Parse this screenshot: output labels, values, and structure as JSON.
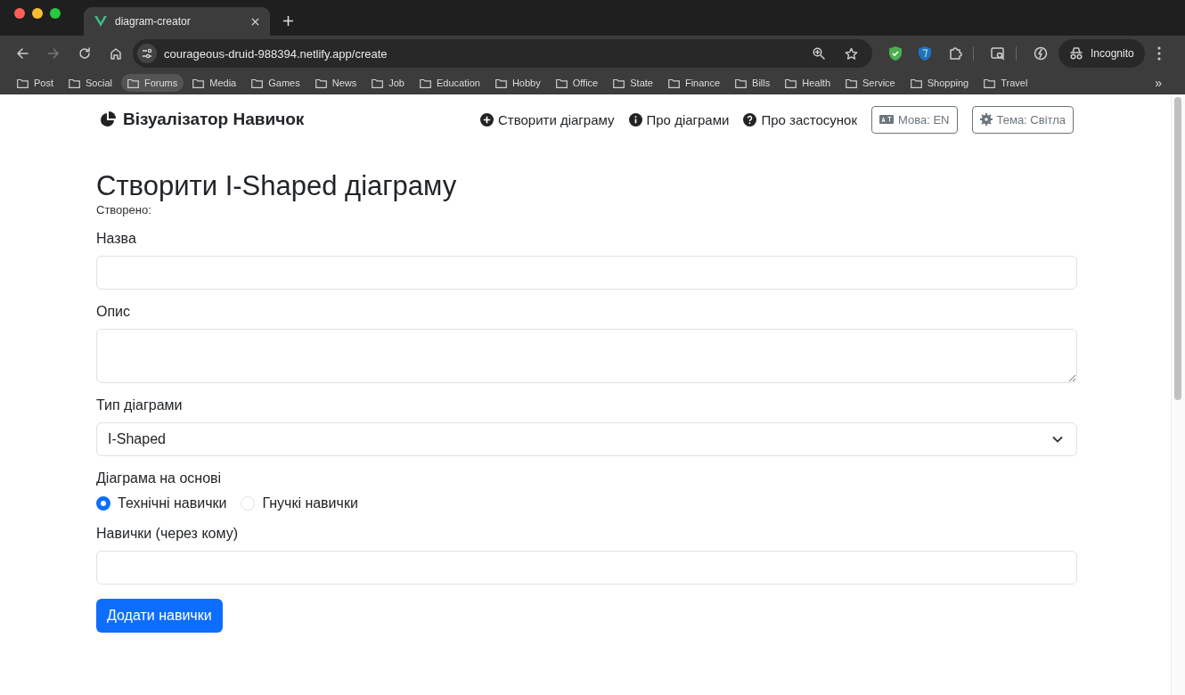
{
  "browser": {
    "tab": {
      "title": "diagram-creator"
    },
    "address": "courageous-druid-988394.netlify.app/create",
    "profile": "Incognito",
    "bookmarks": [
      {
        "label": "Post",
        "selected": false
      },
      {
        "label": "Social",
        "selected": false
      },
      {
        "label": "Forums",
        "selected": true
      },
      {
        "label": "Media",
        "selected": false
      },
      {
        "label": "Games",
        "selected": false
      },
      {
        "label": "News",
        "selected": false
      },
      {
        "label": "Job",
        "selected": false
      },
      {
        "label": "Education",
        "selected": false
      },
      {
        "label": "Hobby",
        "selected": false
      },
      {
        "label": "Office",
        "selected": false
      },
      {
        "label": "State",
        "selected": false
      },
      {
        "label": "Finance",
        "selected": false
      },
      {
        "label": "Bills",
        "selected": false
      },
      {
        "label": "Health",
        "selected": false
      },
      {
        "label": "Service",
        "selected": false
      },
      {
        "label": "Shopping",
        "selected": false
      },
      {
        "label": "Travel",
        "selected": false
      }
    ],
    "more": "»"
  },
  "navbar": {
    "brand": "Візуалізатор Навичок",
    "links": [
      {
        "label": "Створити діаграму",
        "kind": "plus"
      },
      {
        "label": "Про діаграми",
        "kind": "info"
      },
      {
        "label": "Про застосунок",
        "kind": "question"
      }
    ],
    "buttons": [
      {
        "label": "Мова: EN",
        "kind": "language"
      },
      {
        "label": "Тема: Світла",
        "kind": "theme"
      }
    ]
  },
  "form": {
    "title": "Створити I-Shaped діаграму",
    "created": "Створено:",
    "fields": [
      {
        "label": "Назва",
        "kind": "input"
      },
      {
        "label": "Опис",
        "kind": "textarea"
      },
      {
        "label": "Тип діаграми",
        "kind": "select",
        "value": "I-Shaped"
      },
      {
        "label": "Діаграма на основі",
        "kind": "radios",
        "options": [
          {
            "label": "Технічні навички",
            "selected": true
          },
          {
            "label": "Гнучкі навички",
            "selected": false
          }
        ]
      },
      {
        "label": "Навички (через кому)",
        "kind": "input"
      }
    ],
    "submit": "Додати навички"
  }
}
